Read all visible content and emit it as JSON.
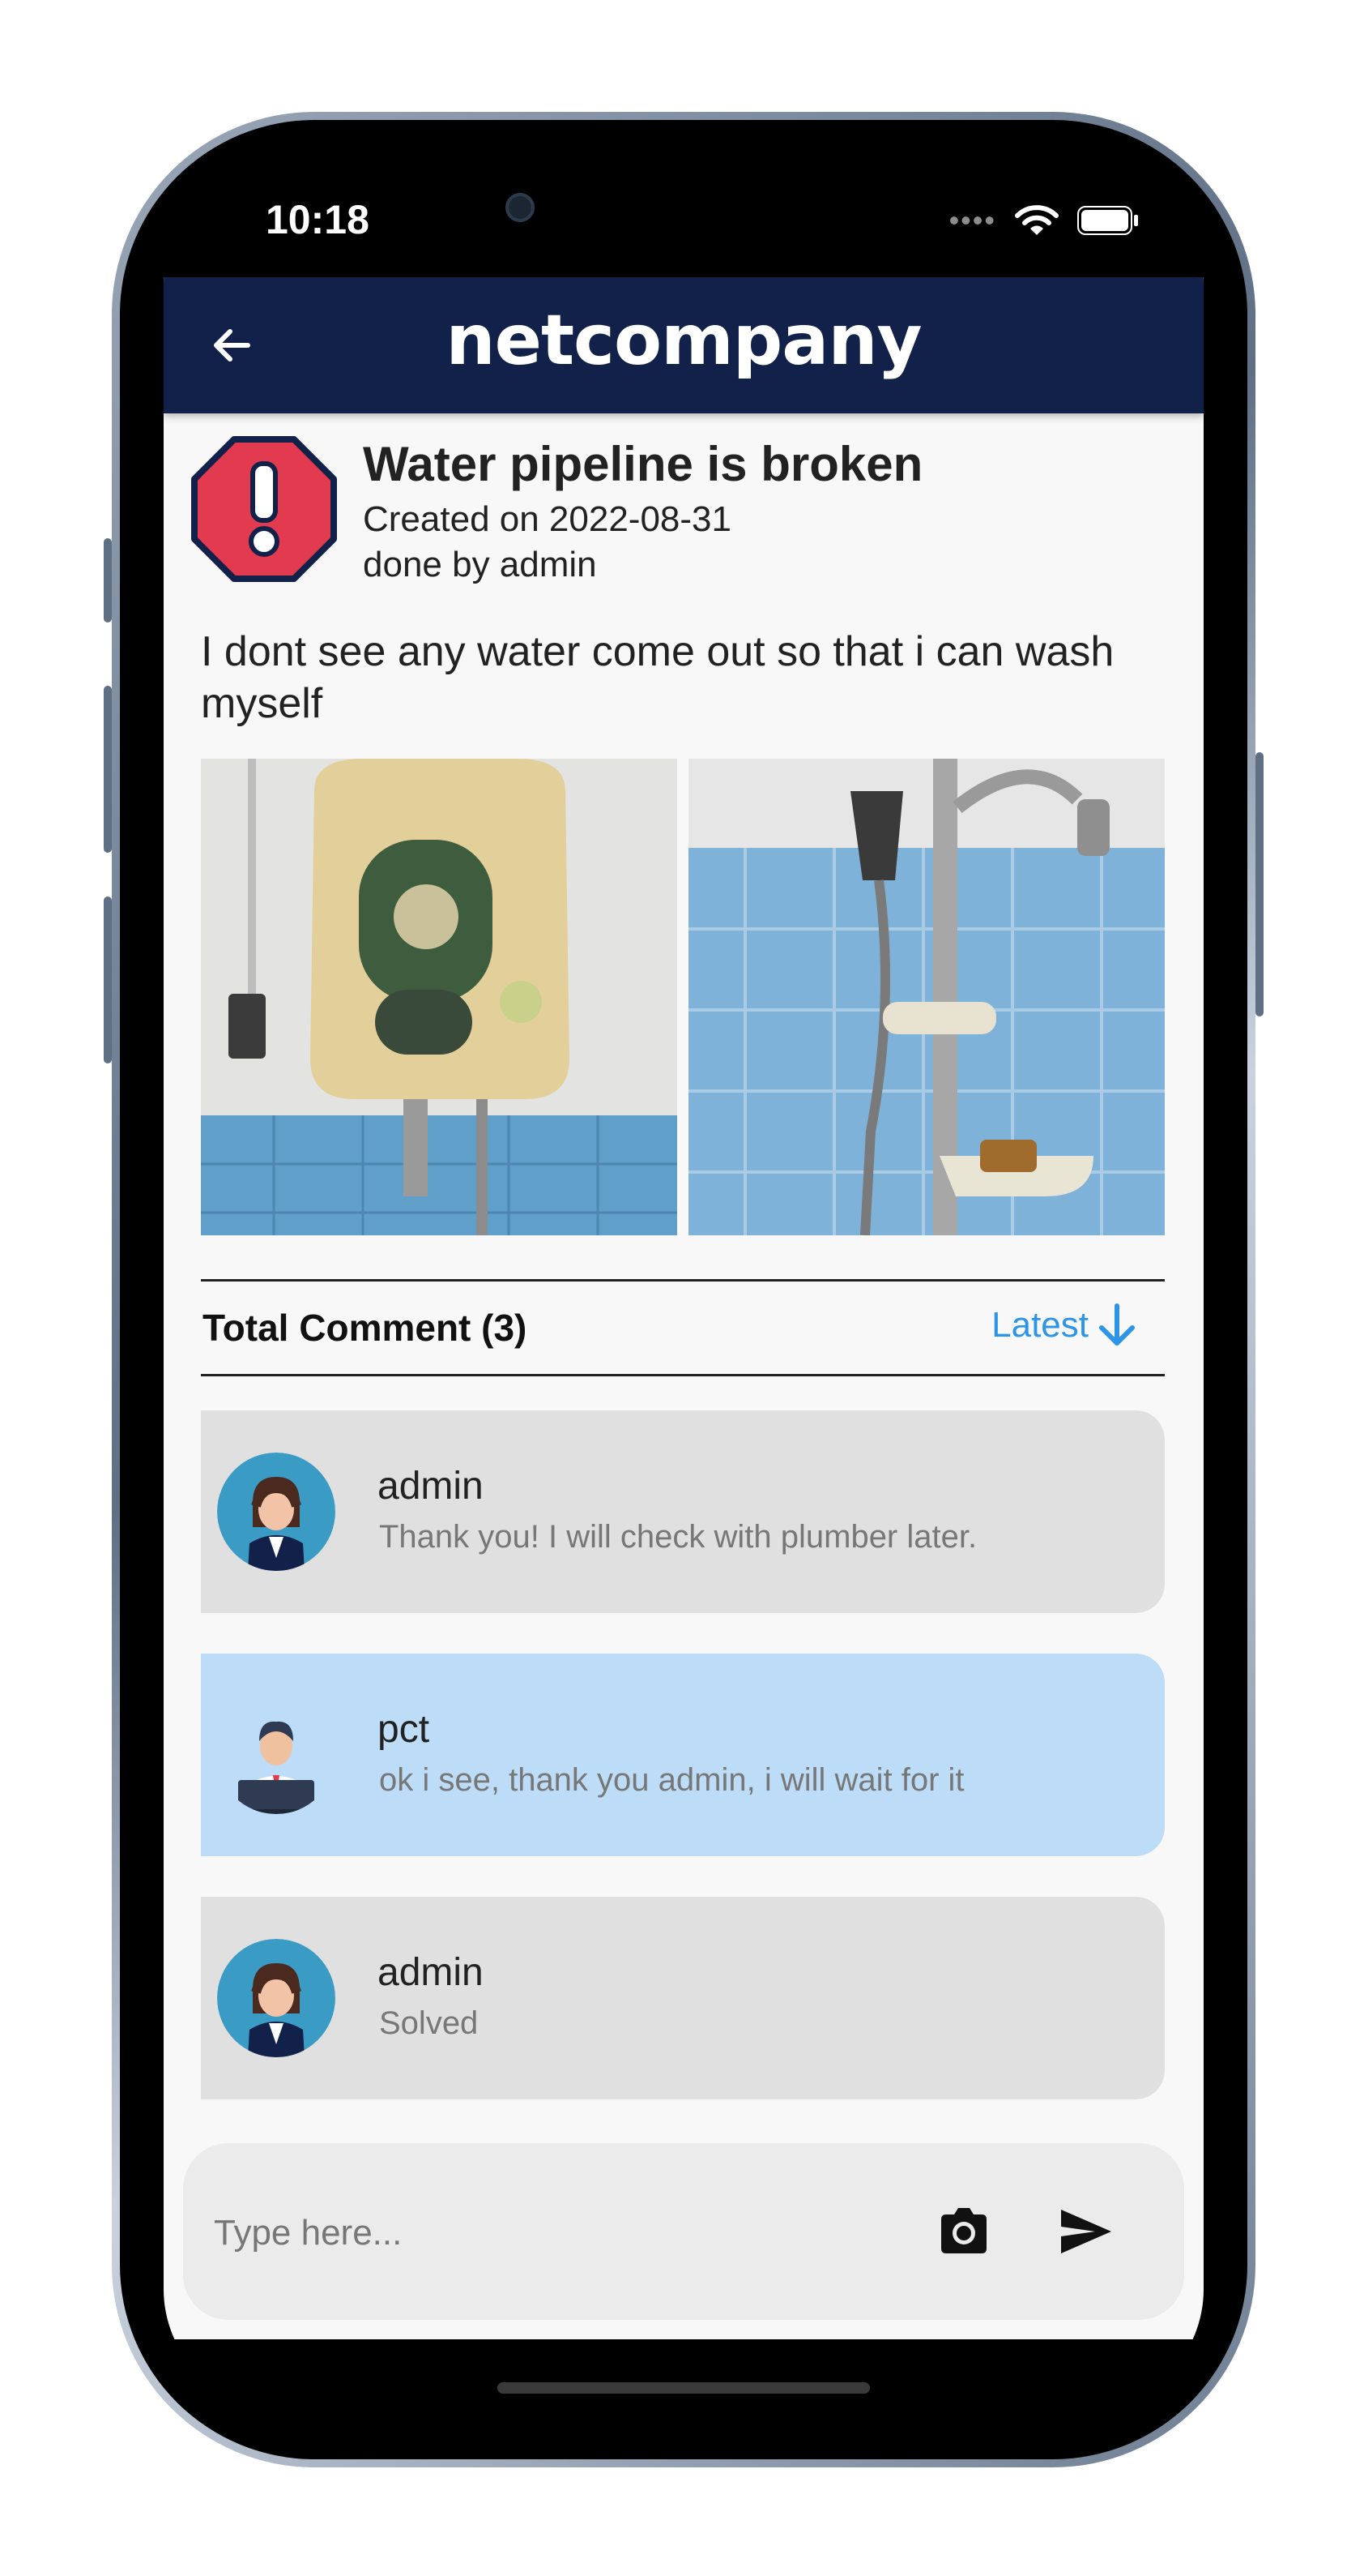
{
  "status_bar": {
    "time": "10:18"
  },
  "app_bar": {
    "title": "netcompany"
  },
  "issue": {
    "title": "Water pipeline is broken",
    "created": "Created on 2022-08-31",
    "author": "done by admin",
    "description": "I dont see any water come out so that i can wash myself"
  },
  "comments_section": {
    "count_label": "Total Comment (3)",
    "sort_label": "Latest"
  },
  "comments": [
    {
      "author": "admin",
      "text": "Thank you! I will check with plumber later."
    },
    {
      "author": "pct",
      "text": "ok i see, thank you admin, i will wait for it"
    },
    {
      "author": "admin",
      "text": "Solved"
    }
  ],
  "composer": {
    "placeholder": "Type here..."
  },
  "colors": {
    "app_bar": "#12214a",
    "accent": "#2d95e8",
    "warning": "#e23a4e",
    "other_comment_bg": "#e0e0e0",
    "own_comment_bg": "#bcdcf7"
  },
  "icons": [
    "back-arrow-icon",
    "warning-icon",
    "arrow-down-icon",
    "camera-icon",
    "send-icon",
    "wifi-icon",
    "battery-icon"
  ]
}
